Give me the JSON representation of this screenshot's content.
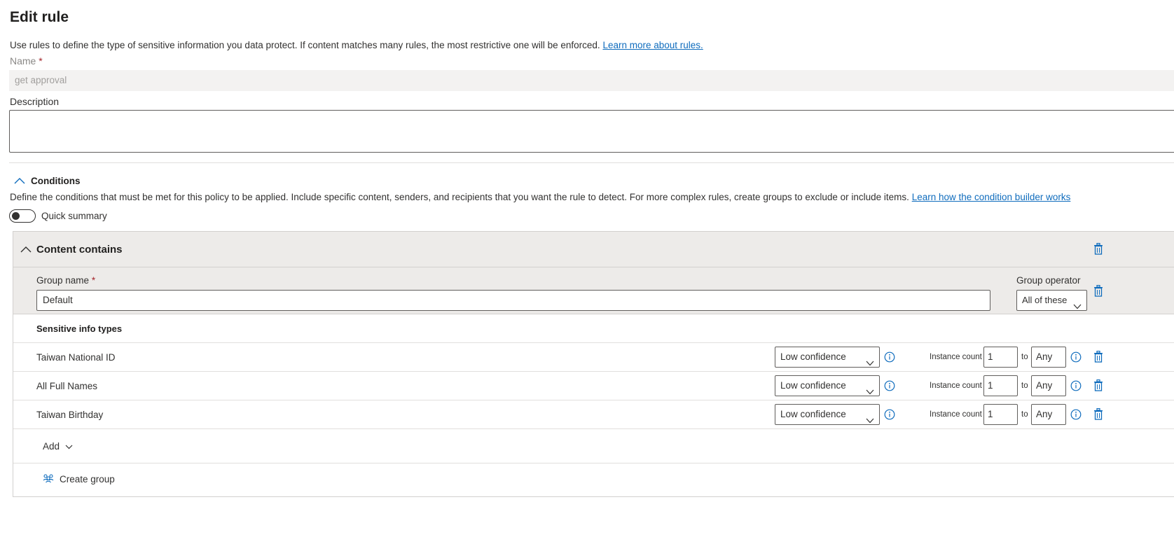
{
  "page": {
    "title": "Edit rule",
    "intro": "Use rules to define the type of sensitive information you data protect. If content matches many rules, the most restrictive one will be enforced.",
    "intro_link": "Learn more about rules."
  },
  "name_field": {
    "label": "Name",
    "required_mark": "*",
    "value": "get approval"
  },
  "description_field": {
    "label": "Description",
    "value": ""
  },
  "conditions": {
    "label": "Conditions",
    "description": "Define the conditions that must be met for this policy to be applied. Include specific content, senders, and recipients that you want the rule to detect. For more complex rules, create groups to exclude or include items.",
    "link": "Learn how the condition builder works",
    "quick_summary_label": "Quick summary",
    "quick_summary_on": false
  },
  "content_contains": {
    "title": "Content contains",
    "group_name_label": "Group name",
    "group_name_required": "*",
    "group_name_value": "Default",
    "group_operator_label": "Group operator",
    "group_operator_value": "All of these",
    "sensitive_info_header": "Sensitive info types",
    "instance_count_label": "Instance count",
    "to_label": "to",
    "items": [
      {
        "name": "Taiwan National ID",
        "confidence": "Low confidence",
        "min": "1",
        "max": "Any"
      },
      {
        "name": "All Full Names",
        "confidence": "Low confidence",
        "min": "1",
        "max": "Any"
      },
      {
        "name": "Taiwan Birthday",
        "confidence": "Low confidence",
        "min": "1",
        "max": "Any"
      }
    ],
    "add_label": "Add",
    "create_group_label": "Create group"
  },
  "colors": {
    "accent": "#0f6cbd",
    "required": "#a4262c",
    "panel_bg": "#edebe9"
  }
}
